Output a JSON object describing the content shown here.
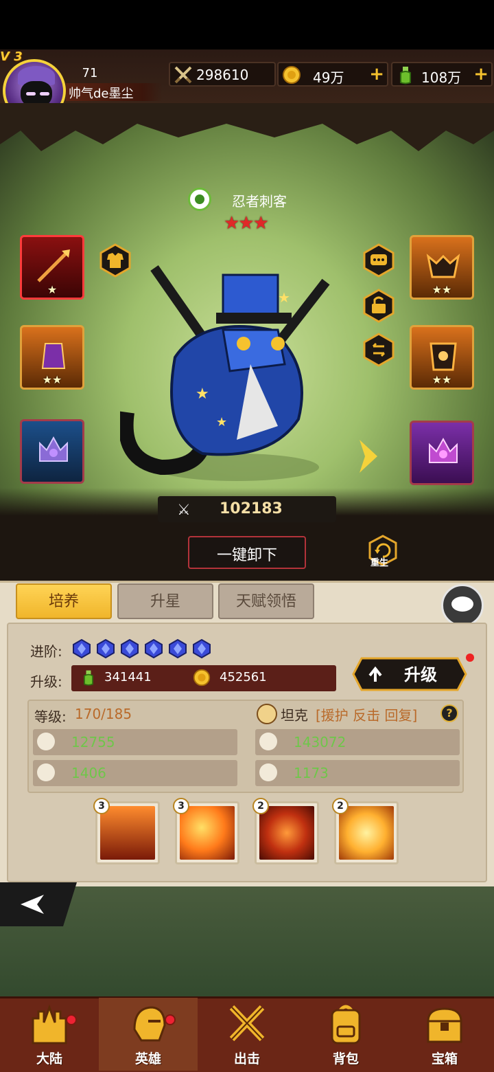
{
  "player": {
    "vip": "V 3",
    "level": "71",
    "name": "帅气de墨尘"
  },
  "resources": {
    "power": "298610",
    "gold": "49万",
    "potion": "108万"
  },
  "hero": {
    "name": "忍者刺客",
    "stars": "★★★",
    "power": "102183"
  },
  "equipment": {
    "slot1_stars": "★",
    "slot2_stars": "★★",
    "slot4_stars": "★★",
    "slot5_stars": "★★"
  },
  "actions": {
    "unequip_all": "一键卸下",
    "reborn": "重生"
  },
  "tabs": [
    "培养",
    "升星",
    "天赋领悟"
  ],
  "cultivate": {
    "advance_label": "进阶:",
    "advance_gems": 6,
    "upgrade_label": "升级:",
    "cost_potion": "341441",
    "cost_gold": "452561",
    "upgrade_button": "升级",
    "level_label": "等级:",
    "level_value": "170/185",
    "role": "坦克",
    "role_tags": "[援护 反击 回复]",
    "help": "?",
    "stats": {
      "attack": "12755",
      "hp": "143072",
      "defense": "1406",
      "speed": "1173"
    }
  },
  "skills": [
    {
      "level": "3",
      "icon": "warrior-silhouette-icon"
    },
    {
      "level": "3",
      "icon": "fire-swirl-icon"
    },
    {
      "level": "2",
      "icon": "tornado-fire-icon"
    },
    {
      "level": "2",
      "icon": "dancer-light-icon"
    }
  ],
  "nav": [
    "大陆",
    "英雄",
    "出击",
    "背包",
    "宝箱"
  ],
  "colors": {
    "accent": "#f0b52b",
    "danger": "#e22222",
    "stat_value": "#6fc64a"
  }
}
